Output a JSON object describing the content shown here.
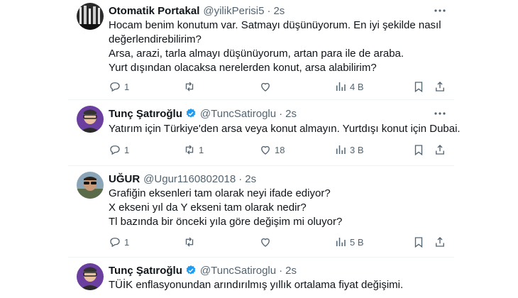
{
  "tweets": [
    {
      "name": "Otomatik Portakal",
      "handle": "@yilikPerisi5",
      "time": "2s",
      "verified": false,
      "avatar": "tree-avatar",
      "lines": [
        "Hocam benim konutum var. Satmayı düşünüyorum. En iyi şekilde nasıl",
        "değerlendirebilirim?",
        "Arsa, arazi, tarla almayı düşünüyorum, artan para ile de araba.",
        "Yurt dışından olacaksa nerelerden konut, arsa alabilirim?"
      ],
      "replies": "1",
      "retweets": "",
      "likes": "",
      "views": "4 B"
    },
    {
      "name": "Tunç Şatıroğlu",
      "handle": "@TuncSatiroglu",
      "time": "2s",
      "verified": true,
      "avatar": "person-avatar",
      "lines": [
        "Yatırım için Türkiye'den arsa veya konut almayın. Yurtdışı konut için Dubai."
      ],
      "replies": "1",
      "retweets": "1",
      "likes": "18",
      "views": "3 B"
    },
    {
      "name": "UĞUR",
      "handle": "@Ugur1160802018",
      "time": "2s",
      "verified": false,
      "avatar": "sunglasses-avatar",
      "lines": [
        "Grafiğin eksenleri tam olarak neyi ifade ediyor?",
        "X ekseni yıl da Y ekseni tam olarak nedir?",
        "Tl bazında bir önceki yıla göre değişim mi oluyor?"
      ],
      "replies": "1",
      "retweets": "",
      "likes": "",
      "views": "5 B"
    },
    {
      "name": "Tunç Şatıroğlu",
      "handle": "@TuncSatiroglu",
      "time": "2s",
      "verified": true,
      "avatar": "person-avatar",
      "lines": [
        "TÜİK enflasyonundan arındırılmış yıllık ortalama fiyat değişimi."
      ],
      "replies": "",
      "retweets": "",
      "likes": "",
      "views": ""
    }
  ],
  "colors": {
    "text": "#0f1419",
    "muted": "#536471",
    "verified": "#1d9bf0",
    "divider": "#eff3f4"
  },
  "separator": "·"
}
